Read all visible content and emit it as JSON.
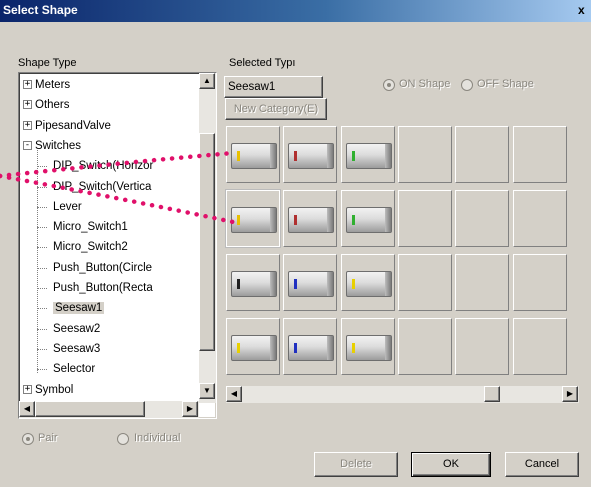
{
  "window": {
    "title": "Select Shape",
    "close_label": "x"
  },
  "shape_type": {
    "label": "Shape Type",
    "tree": [
      {
        "label": "Meters",
        "expander": "+"
      },
      {
        "label": "Others",
        "expander": "+"
      },
      {
        "label": "PipesandValve",
        "expander": "+"
      },
      {
        "label": "Switches",
        "expander": "-"
      },
      {
        "label": "DIP_Switch(Horizor"
      },
      {
        "label": "DIP_Switch(Vertica"
      },
      {
        "label": "Lever"
      },
      {
        "label": "Micro_Switch1"
      },
      {
        "label": "Micro_Switch2"
      },
      {
        "label": "Push_Button(Circle"
      },
      {
        "label": "Push_Button(Recta"
      },
      {
        "label": "Seesaw1",
        "selected": true
      },
      {
        "label": "Seesaw2"
      },
      {
        "label": "Seesaw3"
      },
      {
        "label": "Selector"
      },
      {
        "label": "Symbol",
        "expander": "+"
      }
    ]
  },
  "selected_type": {
    "label": "Selected Typı",
    "value": "Seesaw1",
    "new_category_label": "New Category(E)"
  },
  "shape_state": {
    "on_label": "ON Shape",
    "off_label": "OFF Shape",
    "selected": "on"
  },
  "mode": {
    "pair_label": "Pair",
    "individual_label": "Individual",
    "selected": "pair"
  },
  "grid": {
    "cells": [
      {
        "indicator": "#e8c000"
      },
      {
        "indicator": "#b03030"
      },
      {
        "indicator": "#30b030"
      },
      null,
      null,
      null,
      {
        "indicator": "#e8c000",
        "selected": true
      },
      {
        "indicator": "#b03030"
      },
      {
        "indicator": "#30b030"
      },
      null,
      null,
      null,
      {
        "indicator": "#202020"
      },
      {
        "indicator": "#2030c0"
      },
      {
        "indicator": "#e8d000"
      },
      null,
      null,
      null,
      {
        "indicator": "#e8d000"
      },
      {
        "indicator": "#2030c0"
      },
      {
        "indicator": "#e8d000"
      },
      null,
      null,
      null
    ]
  },
  "buttons": {
    "delete": "Delete",
    "ok": "OK",
    "cancel": "Cancel"
  },
  "colors": {
    "title_start": "#0a246a",
    "title_end": "#a6caf0",
    "face": "#d4d0c8",
    "pointer_dots": "#e0106a"
  }
}
